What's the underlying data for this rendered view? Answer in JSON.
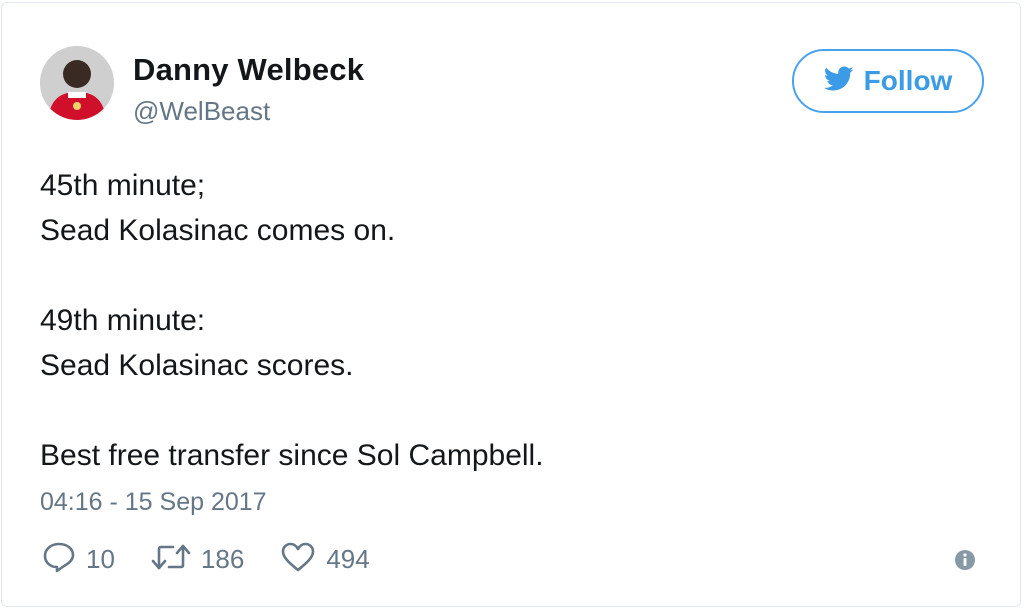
{
  "user": {
    "display_name": "Danny Welbeck",
    "handle": "@WelBeast",
    "avatar_icon": "profile-photo"
  },
  "follow": {
    "label": "Follow",
    "icon": "twitter-bird-icon",
    "color": "#1da1f2"
  },
  "tweet": {
    "lines": [
      "45th minute;",
      "Sead Kolasinac comes on.",
      "",
      "49th minute:",
      "Sead Kolasinac scores.",
      "",
      "Best free transfer since Sol Campbell."
    ],
    "timestamp": "04:16 - 15 Sep 2017"
  },
  "actions": {
    "reply": {
      "icon": "reply-icon",
      "count": "10"
    },
    "retweet": {
      "icon": "retweet-icon",
      "count": "186"
    },
    "like": {
      "icon": "heart-icon",
      "count": "494"
    },
    "info": {
      "icon": "info-icon"
    }
  }
}
